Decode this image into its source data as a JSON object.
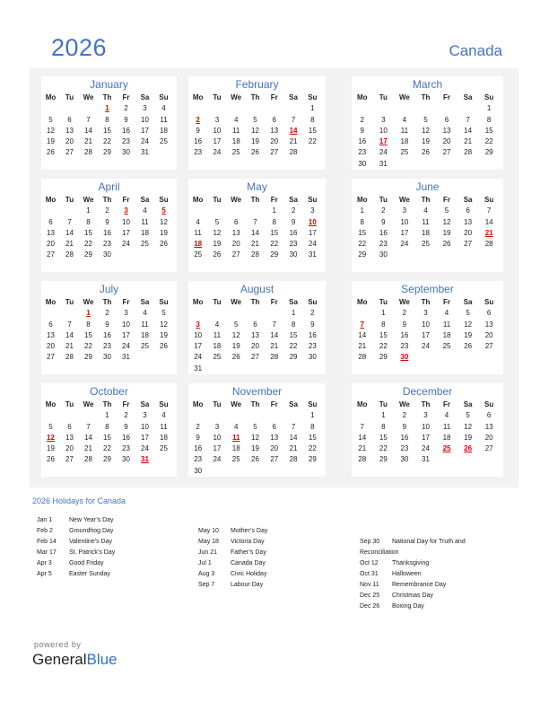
{
  "header": {
    "year": "2026",
    "country": "Canada"
  },
  "weekdays": [
    "Mo",
    "Tu",
    "We",
    "Th",
    "Fr",
    "Sa",
    "Su"
  ],
  "colors": {
    "accent": "#4472c4",
    "holiday": "#e00000",
    "panel": "#f2f2f2"
  },
  "months": [
    {
      "name": "January",
      "offset": 3,
      "days": 31,
      "holidays": [
        1
      ]
    },
    {
      "name": "February",
      "offset": 6,
      "days": 28,
      "holidays": [
        2,
        14
      ]
    },
    {
      "name": "March",
      "offset": 6,
      "days": 31,
      "holidays": [
        17
      ]
    },
    {
      "name": "April",
      "offset": 2,
      "days": 30,
      "holidays": [
        3,
        5
      ]
    },
    {
      "name": "May",
      "offset": 4,
      "days": 31,
      "holidays": [
        10,
        18
      ]
    },
    {
      "name": "June",
      "offset": 0,
      "days": 30,
      "holidays": [
        21
      ]
    },
    {
      "name": "July",
      "offset": 2,
      "days": 31,
      "holidays": [
        1
      ]
    },
    {
      "name": "August",
      "offset": 5,
      "days": 31,
      "holidays": [
        3
      ]
    },
    {
      "name": "September",
      "offset": 1,
      "days": 30,
      "holidays": [
        7,
        30
      ]
    },
    {
      "name": "October",
      "offset": 3,
      "days": 31,
      "holidays": [
        12,
        31
      ]
    },
    {
      "name": "November",
      "offset": 6,
      "days": 30,
      "holidays": [
        11
      ]
    },
    {
      "name": "December",
      "offset": 1,
      "days": 31,
      "holidays": [
        25,
        26
      ]
    }
  ],
  "holidays_section": {
    "title": "2026 Holidays for Canada",
    "columns": [
      [
        {
          "date": "Jan 1",
          "name": "New Year’s Day"
        },
        {
          "date": "Feb 2",
          "name": "Groundhog Day"
        },
        {
          "date": "Feb 14",
          "name": "Valentine’s Day"
        },
        {
          "date": "Mar 17",
          "name": "St. Patrick’s Day"
        },
        {
          "date": "Apr 3",
          "name": "Good Friday"
        },
        {
          "date": "Apr 5",
          "name": "Easter Sunday"
        }
      ],
      [
        {
          "date": "May 10",
          "name": "Mother’s Day"
        },
        {
          "date": "May 18",
          "name": "Victoria Day"
        },
        {
          "date": "Jun 21",
          "name": "Father’s Day"
        },
        {
          "date": "Jul 1",
          "name": "Canada Day"
        },
        {
          "date": "Aug 3",
          "name": "Civic Holiday"
        },
        {
          "date": "Sep 7",
          "name": "Labour Day"
        }
      ],
      [
        {
          "date": "Sep 30",
          "name": "National Day for Truth and Reconciliation"
        },
        {
          "date": "Oct 12",
          "name": "Thanksgiving"
        },
        {
          "date": "Oct 31",
          "name": "Halloween"
        },
        {
          "date": "Nov 11",
          "name": "Remembrance Day"
        },
        {
          "date": "Dec 25",
          "name": "Christmas Day"
        },
        {
          "date": "Dec 26",
          "name": "Boxing Day"
        }
      ]
    ]
  },
  "footer": {
    "powered_by": "powered by",
    "brand_general": "General",
    "brand_blue": "Blue"
  }
}
